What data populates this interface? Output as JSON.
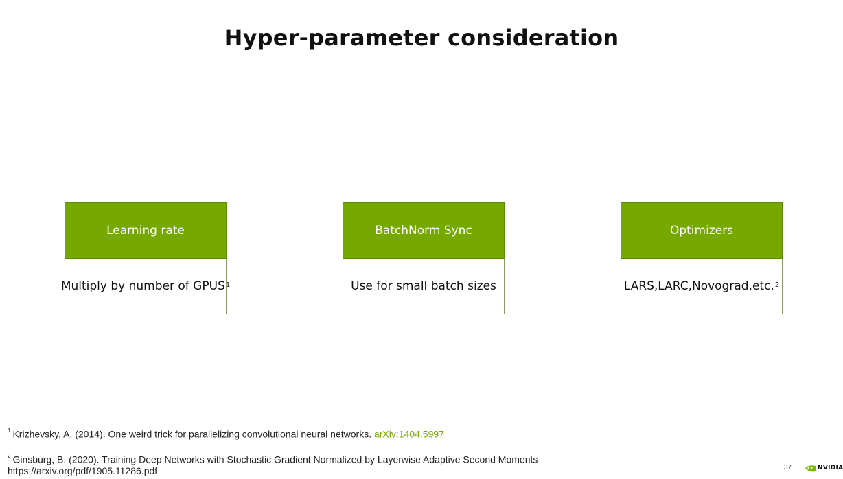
{
  "slide": {
    "title": "Hyper-parameter consideration",
    "page_number": "37"
  },
  "cards": [
    {
      "header": "Learning rate",
      "body": "Multiply by number of GPUS",
      "body_sup": "1"
    },
    {
      "header": "BatchNorm Sync",
      "body": "Use for small batch sizes",
      "body_sup": ""
    },
    {
      "header": "Optimizers",
      "body": "LARS,LARC,Novograd,etc.",
      "body_sup": "2"
    }
  ],
  "footnotes": [
    {
      "marker": "1",
      "text": "Krizhevsky, A. (2014). One weird trick for parallelizing convolutional neural networks. ",
      "link": "arXiv:1404.5997"
    },
    {
      "marker": "2",
      "text": "Ginsburg, B. (2020). Training Deep Networks with Stochastic Gradient Normalized by Layerwise Adaptive Second Moments https://arxiv.org/pdf/1905.11286.pdf"
    }
  ],
  "logo": {
    "text": "NVIDIA",
    "icon": "nvidia-eye-icon",
    "color": "#76b900"
  },
  "colors": {
    "accent": "#76a900"
  }
}
